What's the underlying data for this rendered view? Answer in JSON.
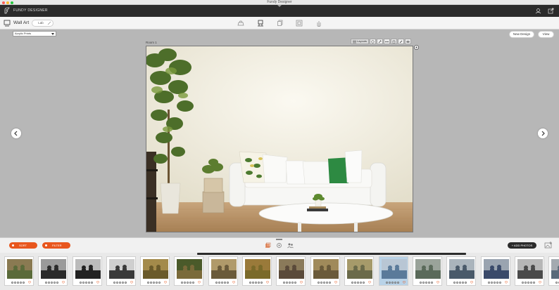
{
  "window": {
    "title": "Fundy Designer"
  },
  "app": {
    "brand": "FUNDY DESIGNER"
  },
  "product": {
    "title": "Wall Art",
    "size_label": "Lab"
  },
  "canvas": {
    "finish_select": "Acrylic Prints",
    "room_label": "Room 1",
    "layouts_label": "Layouts",
    "new_design_label": "New Design",
    "view_label": "View"
  },
  "bottom": {
    "sort_label": "SORT",
    "filter_label": "FILTER",
    "add_photos_label": "+ ADD PHOTOS"
  },
  "colors": {
    "accent": "#e8561d",
    "header": "#2b2b2b",
    "selected_thumb": "#b9d3e8"
  },
  "thumbnails": [
    {
      "name": "family-group-forest",
      "selected": false
    },
    {
      "name": "couple-bw-portrait",
      "selected": false
    },
    {
      "name": "family-bw-walk",
      "selected": false
    },
    {
      "name": "family-bw-bench",
      "selected": false
    },
    {
      "name": "family-fall-trees",
      "selected": false
    },
    {
      "name": "boy-portrait",
      "selected": false
    },
    {
      "name": "family-group-sitting",
      "selected": false
    },
    {
      "name": "family-group-field",
      "selected": false
    },
    {
      "name": "family-couple-standing",
      "selected": false
    },
    {
      "name": "portrait-autumn",
      "selected": false
    },
    {
      "name": "family-group-trees",
      "selected": false
    },
    {
      "name": "family-lake",
      "selected": true
    },
    {
      "name": "family-field-hug",
      "selected": false
    },
    {
      "name": "couple-closeup",
      "selected": false
    },
    {
      "name": "family-collage",
      "selected": false
    },
    {
      "name": "woman-portrait",
      "selected": false
    },
    {
      "name": "partial-thumb",
      "selected": false
    }
  ]
}
